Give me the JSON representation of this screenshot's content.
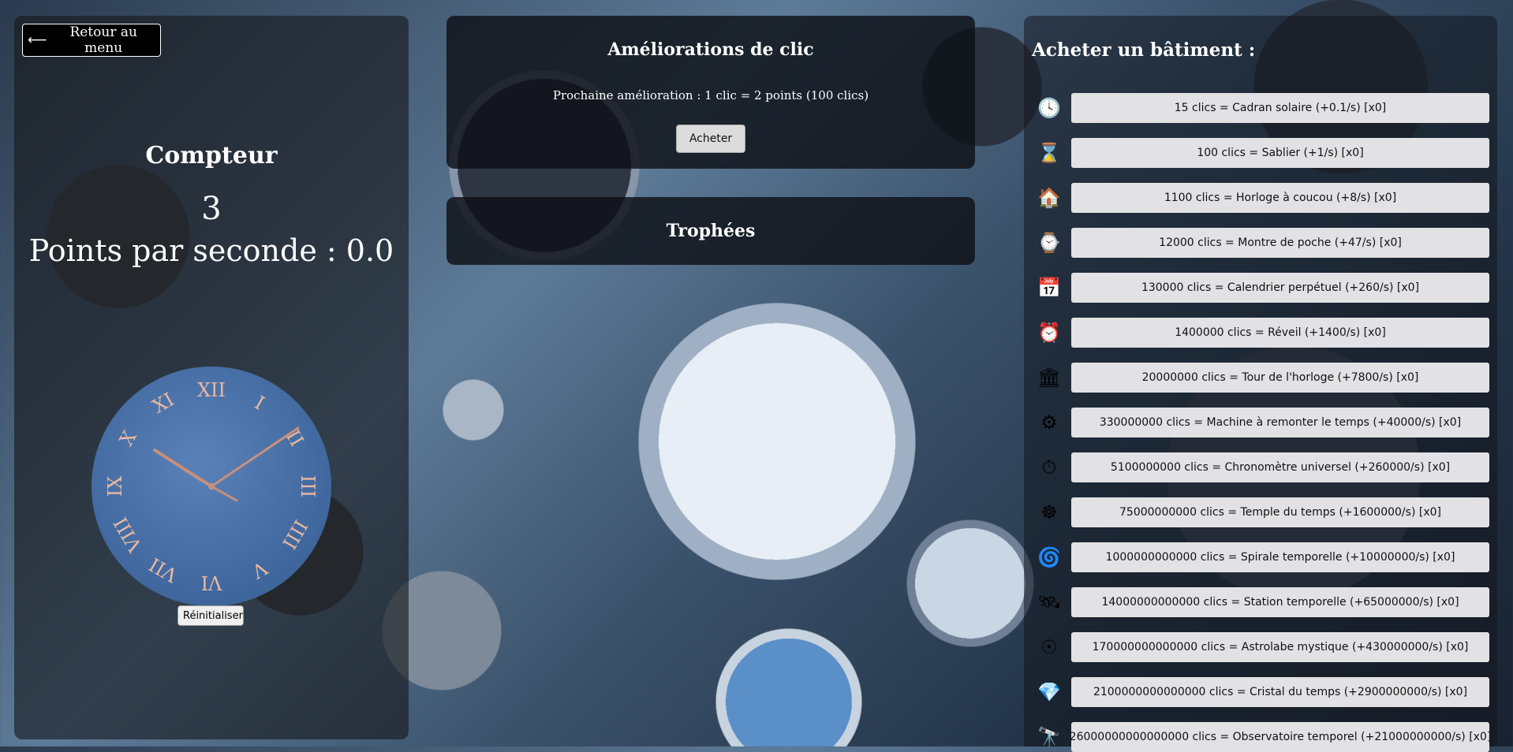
{
  "left": {
    "back_label": "Retour au menu",
    "counter_title": "Compteur",
    "counter_value": "3",
    "pps_label": "Points par seconde : 0.0",
    "reset_label": "Réinitialiser",
    "clock_numerals": [
      "XII",
      "I",
      "II",
      "III",
      "IIII",
      "V",
      "VI",
      "VII",
      "VIII",
      "IX",
      "X",
      "XI"
    ]
  },
  "upgrades": {
    "title": "Améliorations de clic",
    "next_text": "Prochaine amélioration : 1 clic = 2 points (100 clics)",
    "buy_label": "Acheter"
  },
  "trophies": {
    "title": "Trophées"
  },
  "shop": {
    "title": "Acheter un bâtiment :",
    "buildings": [
      {
        "icon": "sundial-icon",
        "glyph": "🕓",
        "label": "15 clics = Cadran solaire (+0.1/s) [x0]"
      },
      {
        "icon": "hourglass-icon",
        "glyph": "⌛",
        "label": "100 clics = Sablier (+1/s) [x0]"
      },
      {
        "icon": "cuckoo-clock-icon",
        "glyph": "🏠",
        "label": "1100 clics = Horloge à coucou (+8/s) [x0]"
      },
      {
        "icon": "pocket-watch-icon",
        "glyph": "⌚",
        "label": "12000 clics = Montre de poche (+47/s) [x0]"
      },
      {
        "icon": "calendar-icon",
        "glyph": "📅",
        "label": "130000 clics = Calendrier perpétuel (+260/s) [x0]"
      },
      {
        "icon": "alarm-clock-icon",
        "glyph": "⏰",
        "label": "1400000 clics = Réveil (+1400/s) [x0]"
      },
      {
        "icon": "clock-tower-icon",
        "glyph": "🏛",
        "label": "20000000 clics = Tour de l'horloge (+7800/s) [x0]"
      },
      {
        "icon": "time-machine-icon",
        "glyph": "⚙",
        "label": "330000000 clics = Machine à remonter le temps (+40000/s) [x0]"
      },
      {
        "icon": "stopwatch-icon",
        "glyph": "⏱",
        "label": "5100000000 clics = Chronomètre universel (+260000/s) [x0]"
      },
      {
        "icon": "temple-icon",
        "glyph": "☸",
        "label": "75000000000 clics = Temple du temps (+1600000/s) [x0]"
      },
      {
        "icon": "spiral-icon",
        "glyph": "🌀",
        "label": "1000000000000 clics = Spirale temporelle (+10000000/s) [x0]"
      },
      {
        "icon": "space-station-icon",
        "glyph": "🛰",
        "label": "14000000000000 clics = Station temporelle (+65000000/s) [x0]"
      },
      {
        "icon": "astrolabe-icon",
        "glyph": "☉",
        "label": "170000000000000 clics = Astrolabe mystique (+430000000/s) [x0]"
      },
      {
        "icon": "crystal-icon",
        "glyph": "💎",
        "label": "2100000000000000 clics = Cristal du temps (+2900000000/s) [x0]"
      },
      {
        "icon": "observatory-icon",
        "glyph": "🔭",
        "label": "26000000000000000 clics = Observatoire temporel (+21000000000/s) [x0]"
      }
    ]
  },
  "colors": {
    "clock_face": "#4a72a8",
    "clock_marks": "#e8b9a2",
    "button_bg": "#e2e2e4"
  }
}
